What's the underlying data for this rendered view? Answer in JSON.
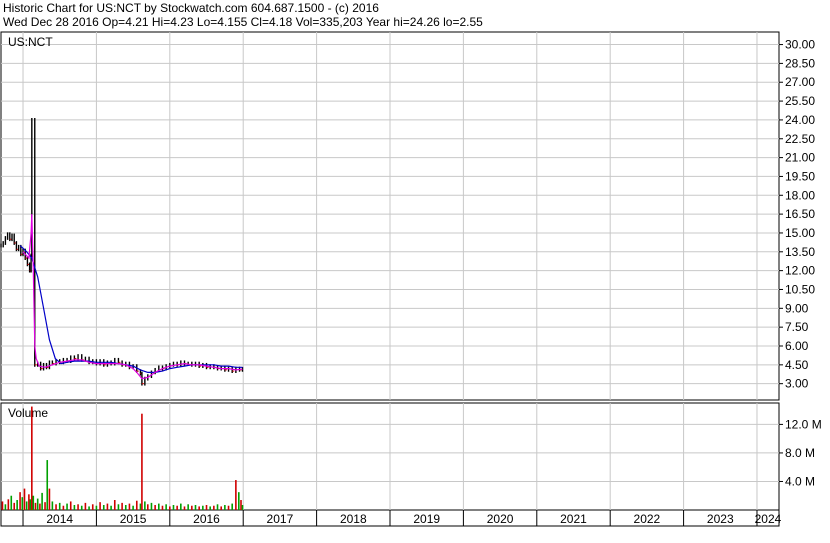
{
  "header": {
    "line1": "Historic Chart for US:NCT by Stockwatch.com 604.687.1500 - (c) 2016",
    "line2": "Wed Dec 28 2016   Op=4.21   Hi=4.23   Lo=4.155   Cl=4.18   Vol=335,203   Year hi=24.26   lo=2.55"
  },
  "price_panel": {
    "label": "US:NCT"
  },
  "volume_panel": {
    "label": "Volume"
  },
  "colors": {
    "grid": "#c8c8c8",
    "frame": "#000000",
    "price_bar": "#000000",
    "down_tick": "#d00000",
    "ma_short": "#e000e0",
    "ma_long": "#0000c8",
    "volume_up": "#00a000",
    "volume_down": "#d00000"
  },
  "chart_data": [
    {
      "type": "line",
      "name_label": "US:NCT",
      "y_ticks": [
        "30.00",
        "28.50",
        "27.00",
        "25.50",
        "24.00",
        "22.50",
        "21.00",
        "19.50",
        "18.00",
        "16.50",
        "15.00",
        "13.50",
        "12.00",
        "10.50",
        "9.00",
        "7.50",
        "6.00",
        "4.50",
        "3.00"
      ],
      "y_tick_values": [
        30.0,
        28.5,
        27.0,
        25.5,
        24.0,
        22.5,
        21.0,
        19.5,
        18.0,
        16.5,
        15.0,
        13.5,
        12.0,
        10.5,
        9.0,
        7.5,
        6.0,
        4.5,
        3.0
      ],
      "x_ticks": [
        "2014",
        "2015",
        "2016",
        "2017",
        "2018",
        "2019",
        "2020",
        "2021",
        "2022",
        "2023",
        "2024"
      ],
      "x_tick_values": [
        2014.0,
        2015.0,
        2016.0,
        2017.0,
        2018.0,
        2019.0,
        2020.0,
        2021.0,
        2022.0,
        2023.0,
        2024.0
      ],
      "x_range": [
        2013.7,
        2024.3
      ],
      "ylim": [
        1.7,
        31.0
      ],
      "price": [
        [
          2013.7,
          14.0
        ],
        [
          2013.73,
          14.2
        ],
        [
          2013.76,
          14.6
        ],
        [
          2013.79,
          14.9
        ],
        [
          2013.82,
          14.5
        ],
        [
          2013.85,
          14.8
        ],
        [
          2013.88,
          14.2
        ],
        [
          2013.91,
          13.7
        ],
        [
          2013.94,
          13.9
        ],
        [
          2013.97,
          13.3
        ],
        [
          2014.0,
          13.6
        ],
        [
          2014.03,
          13.0
        ],
        [
          2014.06,
          12.5
        ],
        [
          2014.09,
          12.0
        ],
        [
          2014.11,
          13.2
        ],
        [
          2014.12,
          24.0
        ],
        [
          2014.16,
          4.5
        ],
        [
          2014.2,
          4.6
        ],
        [
          2014.24,
          4.2
        ],
        [
          2014.28,
          4.5
        ],
        [
          2014.32,
          4.3
        ],
        [
          2014.36,
          4.7
        ],
        [
          2014.4,
          4.6
        ],
        [
          2014.45,
          4.8
        ],
        [
          2014.5,
          4.7
        ],
        [
          2014.55,
          4.9
        ],
        [
          2014.6,
          4.8
        ],
        [
          2014.65,
          5.1
        ],
        [
          2014.7,
          5.0
        ],
        [
          2014.75,
          5.2
        ],
        [
          2014.8,
          4.9
        ],
        [
          2014.85,
          5.0
        ],
        [
          2014.9,
          4.7
        ],
        [
          2014.95,
          4.8
        ],
        [
          2015.0,
          4.6
        ],
        [
          2015.05,
          4.8
        ],
        [
          2015.1,
          4.5
        ],
        [
          2015.15,
          4.7
        ],
        [
          2015.2,
          4.6
        ],
        [
          2015.25,
          4.9
        ],
        [
          2015.3,
          4.7
        ],
        [
          2015.35,
          4.5
        ],
        [
          2015.4,
          4.6
        ],
        [
          2015.45,
          4.3
        ],
        [
          2015.5,
          4.4
        ],
        [
          2015.55,
          4.0
        ],
        [
          2015.6,
          3.8
        ],
        [
          2015.62,
          3.0
        ],
        [
          2015.66,
          3.4
        ],
        [
          2015.7,
          3.6
        ],
        [
          2015.75,
          3.9
        ],
        [
          2015.8,
          4.1
        ],
        [
          2015.85,
          4.3
        ],
        [
          2015.9,
          4.2
        ],
        [
          2015.95,
          4.4
        ],
        [
          2016.0,
          4.5
        ],
        [
          2016.05,
          4.6
        ],
        [
          2016.1,
          4.5
        ],
        [
          2016.15,
          4.7
        ],
        [
          2016.2,
          4.6
        ],
        [
          2016.25,
          4.6
        ],
        [
          2016.3,
          4.5
        ],
        [
          2016.35,
          4.6
        ],
        [
          2016.4,
          4.4
        ],
        [
          2016.45,
          4.5
        ],
        [
          2016.5,
          4.3
        ],
        [
          2016.55,
          4.4
        ],
        [
          2016.6,
          4.3
        ],
        [
          2016.65,
          4.2
        ],
        [
          2016.7,
          4.3
        ],
        [
          2016.75,
          4.1
        ],
        [
          2016.8,
          4.2
        ],
        [
          2016.85,
          4.0
        ],
        [
          2016.9,
          4.2
        ],
        [
          2016.95,
          4.1
        ],
        [
          2016.99,
          4.18
        ]
      ],
      "ma_short": [
        [
          2014.0,
          13.5
        ],
        [
          2014.08,
          13.0
        ],
        [
          2014.11,
          15.0
        ],
        [
          2014.12,
          16.5
        ],
        [
          2014.14,
          12.0
        ],
        [
          2014.16,
          6.0
        ],
        [
          2014.18,
          5.0
        ],
        [
          2014.22,
          4.4
        ],
        [
          2014.3,
          4.3
        ],
        [
          2014.4,
          4.5
        ],
        [
          2014.5,
          4.7
        ],
        [
          2014.6,
          4.8
        ],
        [
          2014.7,
          4.9
        ],
        [
          2014.8,
          4.9
        ],
        [
          2014.9,
          4.7
        ],
        [
          2015.0,
          4.6
        ],
        [
          2015.1,
          4.6
        ],
        [
          2015.2,
          4.6
        ],
        [
          2015.3,
          4.6
        ],
        [
          2015.4,
          4.5
        ],
        [
          2015.5,
          4.2
        ],
        [
          2015.55,
          3.9
        ],
        [
          2015.62,
          3.4
        ],
        [
          2015.7,
          3.5
        ],
        [
          2015.8,
          3.9
        ],
        [
          2015.9,
          4.2
        ],
        [
          2016.0,
          4.4
        ],
        [
          2016.1,
          4.5
        ],
        [
          2016.2,
          4.6
        ],
        [
          2016.3,
          4.5
        ],
        [
          2016.4,
          4.5
        ],
        [
          2016.5,
          4.4
        ],
        [
          2016.6,
          4.3
        ],
        [
          2016.7,
          4.2
        ],
        [
          2016.8,
          4.2
        ],
        [
          2016.9,
          4.1
        ],
        [
          2016.99,
          4.15
        ]
      ],
      "ma_long": [
        [
          2013.96,
          14.0
        ],
        [
          2014.05,
          13.5
        ],
        [
          2014.12,
          13.0
        ],
        [
          2014.2,
          11.5
        ],
        [
          2014.28,
          9.0
        ],
        [
          2014.36,
          6.5
        ],
        [
          2014.44,
          5.0
        ],
        [
          2014.52,
          4.6
        ],
        [
          2014.6,
          4.7
        ],
        [
          2014.7,
          4.8
        ],
        [
          2014.8,
          4.8
        ],
        [
          2014.9,
          4.8
        ],
        [
          2015.0,
          4.7
        ],
        [
          2015.1,
          4.7
        ],
        [
          2015.2,
          4.7
        ],
        [
          2015.3,
          4.6
        ],
        [
          2015.4,
          4.5
        ],
        [
          2015.5,
          4.4
        ],
        [
          2015.6,
          4.1
        ],
        [
          2015.7,
          3.9
        ],
        [
          2015.8,
          3.9
        ],
        [
          2015.9,
          4.0
        ],
        [
          2016.0,
          4.2
        ],
        [
          2016.1,
          4.3
        ],
        [
          2016.2,
          4.4
        ],
        [
          2016.3,
          4.5
        ],
        [
          2016.4,
          4.5
        ],
        [
          2016.5,
          4.5
        ],
        [
          2016.6,
          4.5
        ],
        [
          2016.7,
          4.4
        ],
        [
          2016.8,
          4.4
        ],
        [
          2016.9,
          4.3
        ],
        [
          2016.99,
          4.3
        ]
      ]
    },
    {
      "type": "bar",
      "name_label": "Volume",
      "y_ticks": [
        "12.0 M",
        "8.0 M",
        "4.0 M"
      ],
      "y_tick_values": [
        12.0,
        8.0,
        4.0
      ],
      "ylim": [
        0,
        15.0
      ],
      "unit": "M",
      "volume": [
        [
          2013.72,
          1.2,
          "down"
        ],
        [
          2013.76,
          0.8,
          "up"
        ],
        [
          2013.8,
          1.5,
          "down"
        ],
        [
          2013.84,
          2.0,
          "up"
        ],
        [
          2013.88,
          1.0,
          "down"
        ],
        [
          2013.92,
          1.4,
          "up"
        ],
        [
          2013.96,
          2.5,
          "down"
        ],
        [
          2013.99,
          1.8,
          "up"
        ],
        [
          2014.02,
          3.0,
          "down"
        ],
        [
          2014.05,
          1.2,
          "up"
        ],
        [
          2014.08,
          2.2,
          "down"
        ],
        [
          2014.1,
          1.5,
          "up"
        ],
        [
          2014.12,
          14.5,
          "down"
        ],
        [
          2014.14,
          2.0,
          "up"
        ],
        [
          2014.17,
          1.0,
          "down"
        ],
        [
          2014.2,
          1.6,
          "up"
        ],
        [
          2014.23,
          0.9,
          "down"
        ],
        [
          2014.26,
          2.4,
          "up"
        ],
        [
          2014.3,
          1.1,
          "down"
        ],
        [
          2014.33,
          7.0,
          "up"
        ],
        [
          2014.36,
          3.0,
          "down"
        ],
        [
          2014.4,
          1.2,
          "up"
        ],
        [
          2014.45,
          0.8,
          "down"
        ],
        [
          2014.5,
          1.0,
          "up"
        ],
        [
          2014.55,
          0.6,
          "down"
        ],
        [
          2014.6,
          0.9,
          "up"
        ],
        [
          2014.65,
          1.2,
          "down"
        ],
        [
          2014.7,
          0.7,
          "up"
        ],
        [
          2014.75,
          0.8,
          "down"
        ],
        [
          2014.8,
          0.6,
          "up"
        ],
        [
          2014.85,
          1.0,
          "down"
        ],
        [
          2014.9,
          0.5,
          "up"
        ],
        [
          2014.95,
          0.8,
          "down"
        ],
        [
          2015.0,
          0.6,
          "up"
        ],
        [
          2015.05,
          1.1,
          "down"
        ],
        [
          2015.1,
          0.7,
          "up"
        ],
        [
          2015.15,
          0.9,
          "down"
        ],
        [
          2015.2,
          0.6,
          "up"
        ],
        [
          2015.25,
          1.4,
          "down"
        ],
        [
          2015.3,
          0.8,
          "up"
        ],
        [
          2015.35,
          1.0,
          "down"
        ],
        [
          2015.4,
          0.7,
          "up"
        ],
        [
          2015.45,
          0.9,
          "down"
        ],
        [
          2015.5,
          0.6,
          "up"
        ],
        [
          2015.55,
          1.3,
          "down"
        ],
        [
          2015.6,
          0.9,
          "up"
        ],
        [
          2015.62,
          13.5,
          "down"
        ],
        [
          2015.66,
          1.2,
          "up"
        ],
        [
          2015.7,
          0.8,
          "down"
        ],
        [
          2015.75,
          1.0,
          "up"
        ],
        [
          2015.8,
          0.7,
          "down"
        ],
        [
          2015.85,
          0.9,
          "up"
        ],
        [
          2015.9,
          0.6,
          "down"
        ],
        [
          2015.95,
          0.8,
          "up"
        ],
        [
          2016.0,
          0.5,
          "down"
        ],
        [
          2016.05,
          0.7,
          "up"
        ],
        [
          2016.1,
          0.6,
          "down"
        ],
        [
          2016.15,
          0.9,
          "up"
        ],
        [
          2016.2,
          0.5,
          "down"
        ],
        [
          2016.25,
          0.8,
          "up"
        ],
        [
          2016.3,
          0.6,
          "down"
        ],
        [
          2016.35,
          0.7,
          "up"
        ],
        [
          2016.4,
          0.5,
          "down"
        ],
        [
          2016.45,
          0.6,
          "up"
        ],
        [
          2016.5,
          0.7,
          "down"
        ],
        [
          2016.55,
          0.5,
          "up"
        ],
        [
          2016.6,
          0.6,
          "down"
        ],
        [
          2016.65,
          0.8,
          "up"
        ],
        [
          2016.7,
          0.5,
          "down"
        ],
        [
          2016.75,
          0.7,
          "up"
        ],
        [
          2016.8,
          0.6,
          "down"
        ],
        [
          2016.85,
          0.9,
          "up"
        ],
        [
          2016.9,
          4.2,
          "down"
        ],
        [
          2016.94,
          2.5,
          "up"
        ],
        [
          2016.97,
          1.4,
          "down"
        ],
        [
          2016.99,
          0.7,
          "up"
        ]
      ]
    }
  ]
}
